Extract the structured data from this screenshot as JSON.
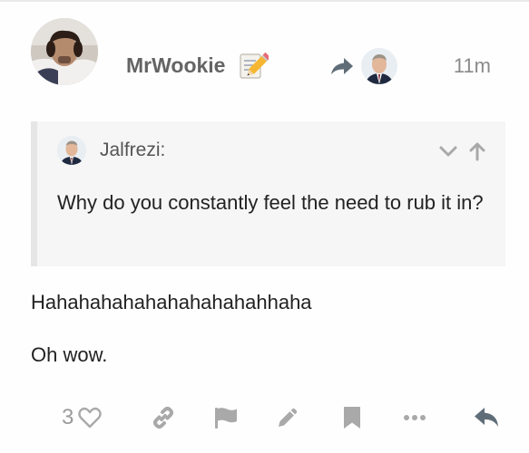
{
  "post": {
    "username": "MrWookie",
    "time": "11m",
    "quote": {
      "author": "Jalfrezi:",
      "text": "Why do you constantly feel the need to rub it in?"
    },
    "lines": [
      "Hahahahahahahahahahahhaha",
      "Oh wow."
    ],
    "like_count": "3"
  },
  "icons": {
    "badge": "memo-pencil-icon",
    "reply_to": "reply-arrow-icon",
    "like": "heart-icon",
    "link": "link-icon",
    "flag": "flag-icon",
    "edit": "pencil-icon",
    "bookmark": "bookmark-icon",
    "more": "ellipsis-icon",
    "reply": "reply-icon"
  },
  "colors": {
    "username": "#646464",
    "muted_icon": "#a9a9a9",
    "reply_icon": "#5f6d78",
    "quote_bg": "#f6f6f6",
    "quote_border": "#e6e6e6"
  }
}
